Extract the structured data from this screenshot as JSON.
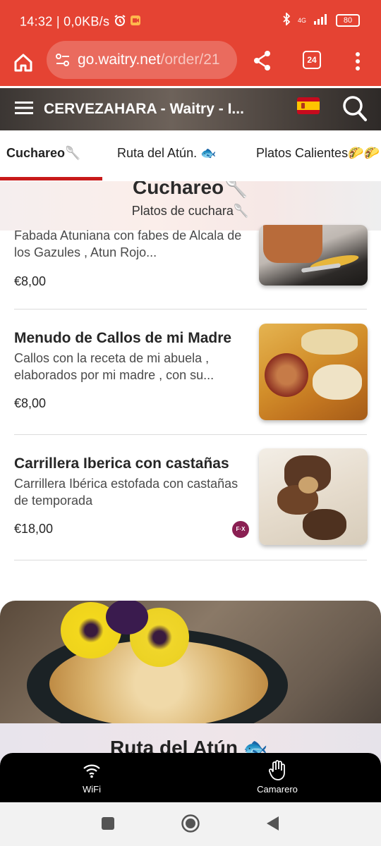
{
  "status_bar": {
    "time": "14:32",
    "speed": "0,0KB/s",
    "network": "4G",
    "battery": "80"
  },
  "browser": {
    "url_main": "go.waitry.net",
    "url_rest": "/order/21",
    "tab_count": "24"
  },
  "header": {
    "title": "CERVEZAHARA - Waitry - I..."
  },
  "tabs": [
    {
      "label": "Cuchareo🥄"
    },
    {
      "label": "Ruta del Atún. 🐟"
    },
    {
      "label": "Platos Calientes🌮🌮"
    }
  ],
  "section": {
    "title": "Cuchareo🥄",
    "subtitle": "Platos de cuchara🥄"
  },
  "items": [
    {
      "name": "",
      "description": "Fabada Atuniana con fabes de Alcala de los Gazules , Atun Rojo...",
      "price": "€8,00"
    },
    {
      "name": "Menudo de Callos de mi Madre",
      "description": "Callos con la receta de mi abuela , elaborados por mi madre , con su...",
      "price": "€8,00"
    },
    {
      "name": "Carrillera Iberica con castañas",
      "description": "Carrillera Ibérica estofada con castañas de temporada",
      "price": "€18,00",
      "allergen": "F·X"
    }
  ],
  "next_section": {
    "title": "Ruta del Atún 🐟"
  },
  "bottom_bar": {
    "wifi_label": "WiFi",
    "waiter_label": "Camarero"
  },
  "colors": {
    "brand": "#e54333",
    "accent": "#c81a1a"
  }
}
